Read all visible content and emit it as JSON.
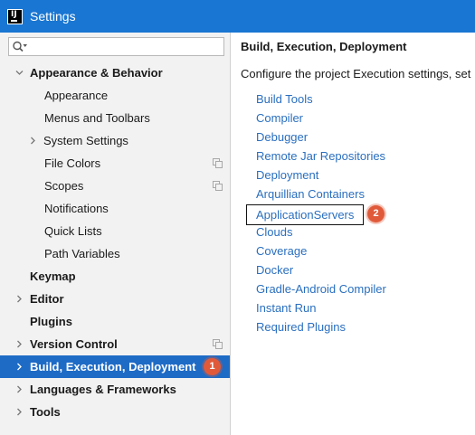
{
  "window": {
    "title": "Settings",
    "app_icon_letter": "IJ"
  },
  "search": {
    "value": "",
    "placeholder": ""
  },
  "tree": [
    {
      "label": "Appearance & Behavior",
      "level": 0,
      "bold": true,
      "arrow": "down"
    },
    {
      "label": "Appearance",
      "level": 2
    },
    {
      "label": "Menus and Toolbars",
      "level": 2
    },
    {
      "label": "System Settings",
      "level": 1,
      "arrow": "right"
    },
    {
      "label": "File Colors",
      "level": 2,
      "copy_icon": true
    },
    {
      "label": "Scopes",
      "level": 2,
      "copy_icon": true
    },
    {
      "label": "Notifications",
      "level": 2
    },
    {
      "label": "Quick Lists",
      "level": 2
    },
    {
      "label": "Path Variables",
      "level": 2
    },
    {
      "label": "Keymap",
      "level": 0,
      "bold": true
    },
    {
      "label": "Editor",
      "level": 0,
      "bold": true,
      "arrow": "right"
    },
    {
      "label": "Plugins",
      "level": 0,
      "bold": true
    },
    {
      "label": "Version Control",
      "level": 0,
      "bold": true,
      "arrow": "right",
      "copy_icon": true
    },
    {
      "label": "Build, Execution, Deployment",
      "level": 0,
      "bold": true,
      "arrow": "right",
      "selected": true,
      "badge": "1"
    },
    {
      "label": "Languages & Frameworks",
      "level": 0,
      "bold": true,
      "arrow": "right"
    },
    {
      "label": "Tools",
      "level": 0,
      "bold": true,
      "arrow": "right"
    }
  ],
  "content": {
    "heading": "Build, Execution, Deployment",
    "description": "Configure the project Execution settings, set",
    "links": [
      {
        "label": "Build Tools"
      },
      {
        "label": "Compiler"
      },
      {
        "label": "Debugger"
      },
      {
        "label": "Remote Jar Repositories"
      },
      {
        "label": "Deployment"
      },
      {
        "label": "Arquillian Containers"
      },
      {
        "label": "ApplicationServers",
        "highlighted": true,
        "badge": "2"
      },
      {
        "label": "Clouds"
      },
      {
        "label": "Coverage"
      },
      {
        "label": "Docker"
      },
      {
        "label": "Gradle-Android Compiler"
      },
      {
        "label": "Instant Run"
      },
      {
        "label": "Required Plugins"
      }
    ]
  },
  "colors": {
    "titlebar": "#1976d2",
    "selection": "#1e6bc6",
    "link": "#2a6fbf",
    "badge": "#e05a3a",
    "sidebar_bg": "#f2f2f2"
  }
}
